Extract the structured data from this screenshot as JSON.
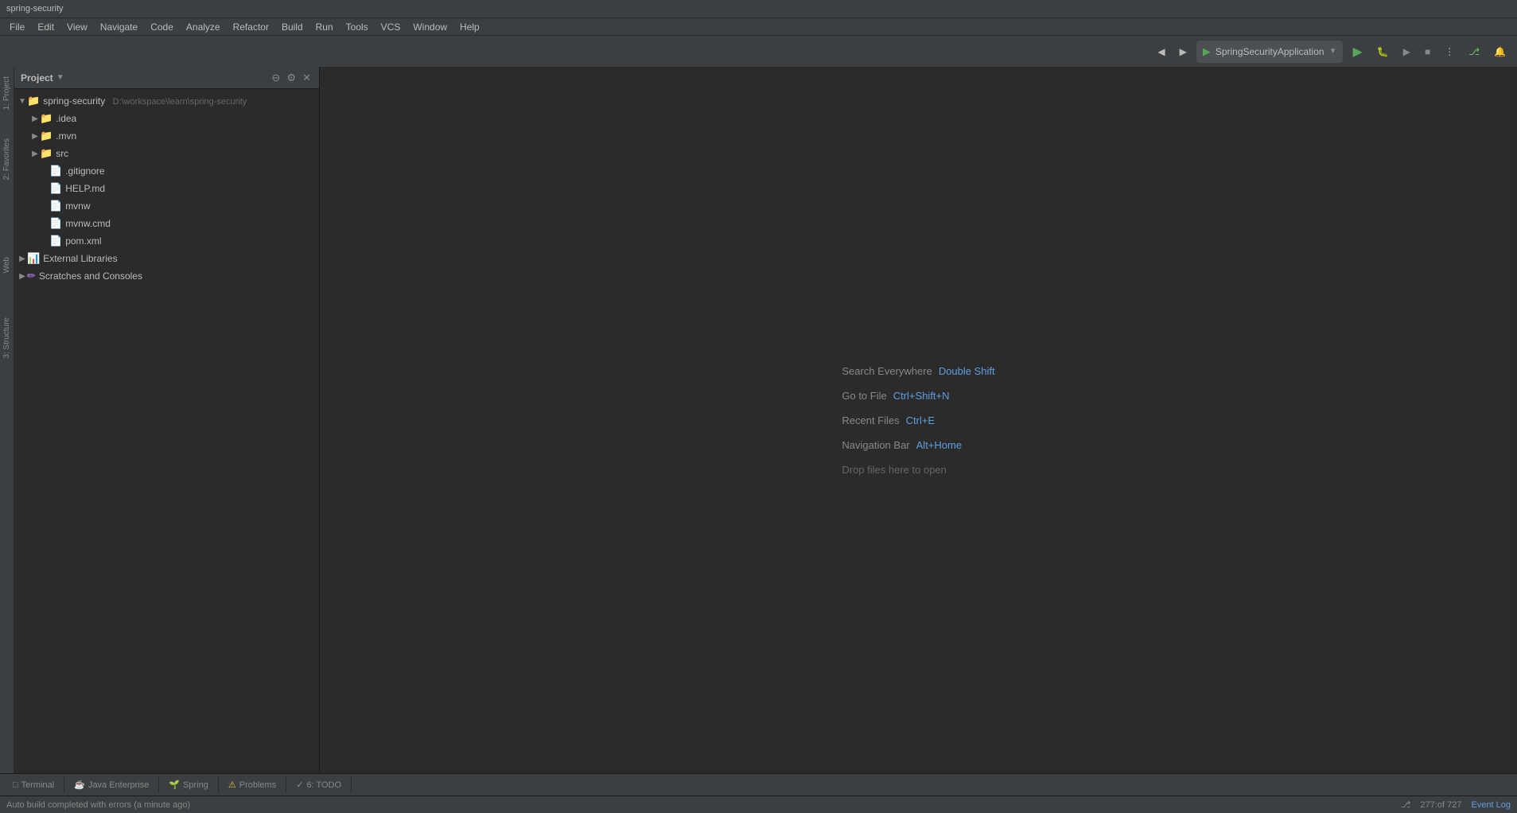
{
  "titleBar": {
    "title": "spring-security"
  },
  "menuBar": {
    "items": [
      "File",
      "Edit",
      "View",
      "Navigate",
      "Code",
      "Analyze",
      "Refactor",
      "Build",
      "Run",
      "Tools",
      "VCS",
      "Window",
      "Help"
    ]
  },
  "projectPanel": {
    "title": "Project",
    "rootProject": {
      "name": "spring-security",
      "path": "D:\\workspace\\learn\\spring-security",
      "expanded": true
    },
    "treeItems": [
      {
        "indent": 1,
        "type": "folder",
        "name": ".idea",
        "expanded": false
      },
      {
        "indent": 1,
        "type": "folder",
        "name": ".mvn",
        "expanded": false
      },
      {
        "indent": 1,
        "type": "folder",
        "name": "src",
        "expanded": false
      },
      {
        "indent": 1,
        "type": "file",
        "name": ".gitignore"
      },
      {
        "indent": 1,
        "type": "file-md",
        "name": "HELP.md"
      },
      {
        "indent": 1,
        "type": "file",
        "name": "mvnw"
      },
      {
        "indent": 1,
        "type": "file",
        "name": "mvnw.cmd"
      },
      {
        "indent": 1,
        "type": "file-xml",
        "name": "pom.xml"
      },
      {
        "indent": 0,
        "type": "lib",
        "name": "External Libraries",
        "expanded": false
      },
      {
        "indent": 0,
        "type": "scratch",
        "name": "Scratches and Consoles",
        "expanded": false
      }
    ]
  },
  "welcomeHints": {
    "searchEverywhere": {
      "label": "Search Everywhere",
      "shortcut": "Double Shift"
    },
    "goToFile": {
      "label": "Go to File",
      "shortcut": "Ctrl+Shift+N"
    },
    "recentFiles": {
      "label": "Recent Files",
      "shortcut": "Ctrl+E"
    },
    "navigationBar": {
      "label": "Navigation Bar",
      "shortcut": "Alt+Home"
    },
    "dropFiles": {
      "label": "Drop files here to open"
    }
  },
  "toolbar": {
    "runConfig": "SpringSecurityApplication",
    "runLabel": "▶",
    "debugLabel": "🐛",
    "profileLabel": "▶"
  },
  "bottomTabs": [
    {
      "icon": "□",
      "label": "Terminal"
    },
    {
      "icon": "☕",
      "label": "Java Enterprise"
    },
    {
      "icon": "🌱",
      "label": "Spring"
    },
    {
      "icon": "⚠",
      "label": "Problems"
    },
    {
      "icon": "✓",
      "label": "6: TODO"
    }
  ],
  "statusBar": {
    "message": "Auto build completed with errors (a minute ago)",
    "position": "277:of 727",
    "eventLog": "Event Log"
  },
  "verticalTabs": [
    {
      "label": "2: Favorites"
    },
    {
      "label": "Web"
    },
    {
      "label": "3: Structure"
    }
  ]
}
